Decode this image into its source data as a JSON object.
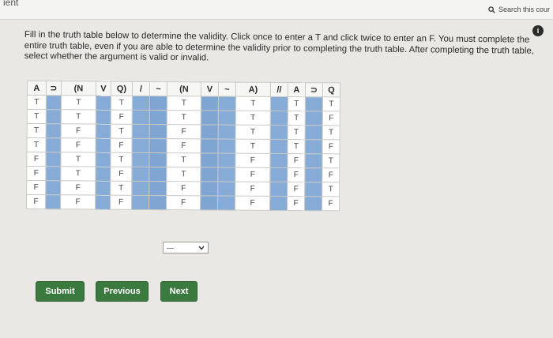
{
  "topbar": {
    "crumb": "ient",
    "search_placeholder": "Search this cour"
  },
  "info_badge": "i",
  "instructions": "Fill in the truth table below to determine the validity. Click once to enter a T and click twice to enter an F. You must complete the entire truth table, even if you are able to determine the validity prior to completing the truth table. After completing the truth table, select whether the argument is valid or invalid.",
  "table": {
    "headers": [
      "A",
      "⊃",
      "(N",
      "V",
      "Q)",
      "/",
      "~",
      "(N",
      "V",
      "~",
      "A)",
      "//",
      "A",
      "⊃",
      "Q"
    ],
    "rows": [
      [
        "T",
        "",
        "T",
        "",
        "T",
        "",
        "",
        "T",
        "",
        "",
        "T",
        "",
        "T",
        "",
        "T"
      ],
      [
        "T",
        "",
        "T",
        "",
        "F",
        "",
        "",
        "T",
        "",
        "",
        "T",
        "",
        "T",
        "",
        "F"
      ],
      [
        "T",
        "",
        "F",
        "",
        "T",
        "",
        "",
        "F",
        "",
        "",
        "T",
        "",
        "T",
        "",
        "T"
      ],
      [
        "T",
        "",
        "F",
        "",
        "F",
        "",
        "",
        "F",
        "",
        "",
        "T",
        "",
        "T",
        "",
        "F"
      ],
      [
        "F",
        "",
        "T",
        "",
        "T",
        "",
        "",
        "T",
        "",
        "",
        "F",
        "",
        "F",
        "",
        "T"
      ],
      [
        "F",
        "",
        "T",
        "",
        "F",
        "",
        "",
        "T",
        "",
        "",
        "F",
        "",
        "F",
        "",
        "F"
      ],
      [
        "F",
        "",
        "F",
        "",
        "T",
        "",
        "",
        "F",
        "",
        "",
        "F",
        "",
        "F",
        "",
        "T"
      ],
      [
        "F",
        "",
        "F",
        "",
        "F",
        "",
        "",
        "F",
        "",
        "",
        "F",
        "",
        "F",
        "",
        "F"
      ]
    ]
  },
  "validity_select": {
    "value": "---"
  },
  "buttons": {
    "submit": "Submit",
    "previous": "Previous",
    "next": "Next"
  },
  "colors": {
    "blank_cell": "#7fa6d2",
    "button": "#3b7a3e"
  }
}
